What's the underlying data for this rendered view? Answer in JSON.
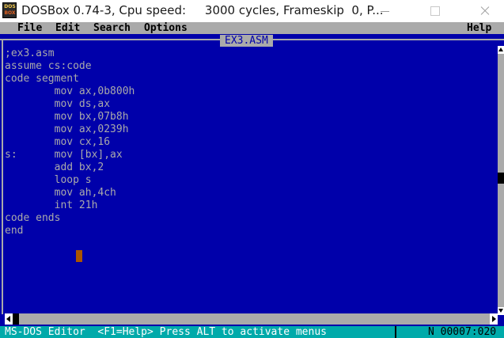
{
  "window": {
    "title": "DOSBox 0.74-3, Cpu speed:     3000 cycles, Frameskip  0, P...",
    "icon_top": "DOS",
    "icon_bottom": "BOX"
  },
  "menu": {
    "file": "File",
    "edit": "Edit",
    "search": "Search",
    "options": "Options",
    "help": "Help"
  },
  "document": {
    "filename": "EX3.ASM",
    "lines": [
      ";ex3.asm",
      "assume cs:code",
      "code segment",
      "        mov ax,0b800h",
      "        mov ds,ax",
      "        mov bx,07b8h",
      "        mov ax,0239h",
      "        mov cx,16",
      "s:      mov [bx],ax",
      "        add bx,2",
      "        loop s",
      "        mov ah,4ch",
      "        int 21h",
      "code ends",
      "end"
    ]
  },
  "status": {
    "message": "MS-DOS Editor  <F1=Help> Press ALT to activate menus",
    "position": "N 00007:020"
  },
  "colors": {
    "dos_blue": "#0000aa",
    "dos_gray": "#aaaaaa",
    "dos_cyan": "#00aaaa",
    "cursor": "#aa5500"
  }
}
